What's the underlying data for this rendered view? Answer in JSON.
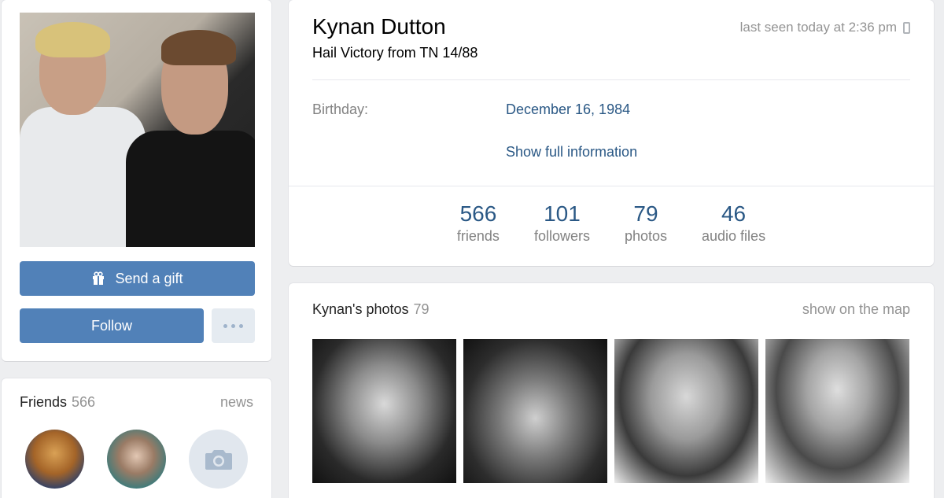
{
  "profile": {
    "name": "Kynan Dutton",
    "status": "Hail Victory from TN 14/88",
    "last_seen": "last seen today at 2:36 pm",
    "birthday_label": "Birthday:",
    "birthday_value": "December 16, 1984",
    "show_full": "Show full information"
  },
  "counters": [
    {
      "value": "566",
      "label": "friends"
    },
    {
      "value": "101",
      "label": "followers"
    },
    {
      "value": "79",
      "label": "photos"
    },
    {
      "value": "46",
      "label": "audio files"
    }
  ],
  "actions": {
    "gift_label": "Send a gift",
    "follow_label": "Follow"
  },
  "friends": {
    "title": "Friends",
    "count": "566",
    "news": "news"
  },
  "photos": {
    "title": "Kynan's photos",
    "count": "79",
    "map_link": "show on the map"
  },
  "colors": {
    "accent": "#5181b8",
    "link": "#2a5885",
    "background": "#edeef0"
  },
  "icons": [
    "gift-icon",
    "phone-icon",
    "more-icon",
    "camera-icon"
  ]
}
